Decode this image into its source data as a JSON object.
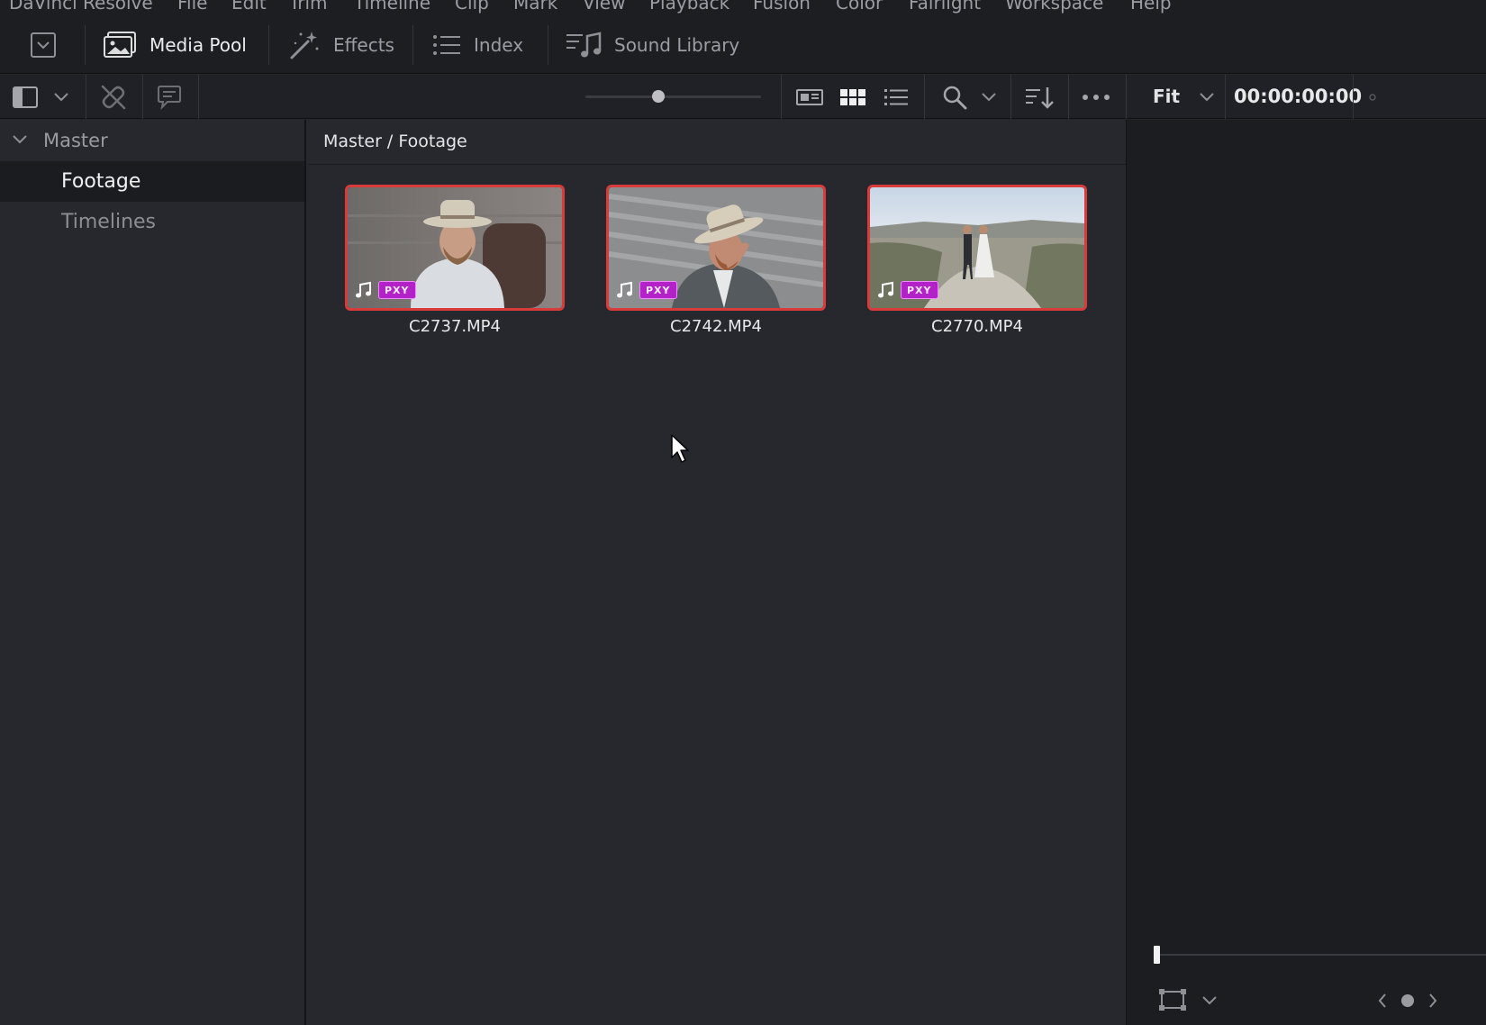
{
  "menu": [
    "DaVinci Resolve",
    "File",
    "Edit",
    "Trim",
    "Timeline",
    "Clip",
    "Mark",
    "View",
    "Playback",
    "Fusion",
    "Color",
    "Fairlight",
    "Workspace",
    "Help"
  ],
  "modules": {
    "media_pool": "Media Pool",
    "effects": "Effects",
    "index": "Index",
    "sound_library": "Sound Library"
  },
  "viewer": {
    "zoom": "Fit",
    "timecode": "00:00:00:00"
  },
  "bins": {
    "master": "Master",
    "items": [
      {
        "label": "Footage",
        "selected": true
      },
      {
        "label": "Timelines",
        "selected": false
      }
    ]
  },
  "pool": {
    "breadcrumb": "Master / Footage",
    "clips": [
      {
        "name": "C2737.MP4",
        "badge": "PXY",
        "icon": "music-note-icon"
      },
      {
        "name": "C2742.MP4",
        "badge": "PXY",
        "icon": "music-note-icon"
      },
      {
        "name": "C2770.MP4",
        "badge": "PXY",
        "icon": "music-note-icon"
      }
    ]
  },
  "colors": {
    "selection_border": "#d93b3b",
    "proxy_badge": "#b321c9",
    "panel_bg": "#27282e",
    "toolbar_bg": "#1d1e22"
  }
}
